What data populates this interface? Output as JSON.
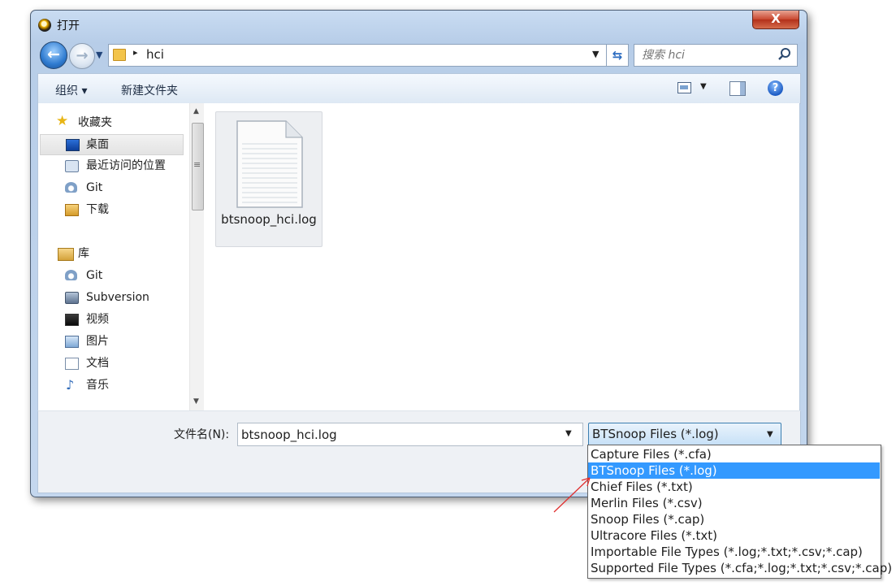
{
  "window": {
    "title": "打开",
    "close_glyph": "X"
  },
  "address": {
    "path_segment": "hci",
    "separator": "▸",
    "search_placeholder": "搜索 hci"
  },
  "toolbar": {
    "organize_label": "组织 ▾",
    "new_folder_label": "新建文件夹",
    "help_glyph": "?"
  },
  "nav": {
    "favorites_label": "收藏夹",
    "desktop_label": "桌面",
    "recent_label": "最近访问的位置",
    "git_label": "Git",
    "downloads_label": "下载",
    "libraries_label": "库",
    "lib_git_label": "Git",
    "subversion_label": "Subversion",
    "videos_label": "视频",
    "pictures_label": "图片",
    "documents_label": "文档",
    "music_label": "音乐"
  },
  "files": [
    {
      "name": "btsnoop_hci.log"
    }
  ],
  "bottom": {
    "filename_label": "文件名(N):",
    "filename_value": "btsnoop_hci.log",
    "filetype_selected": "BTSnoop Files (*.log)"
  },
  "filetype_options": [
    "Capture Files (*.cfa)",
    "BTSnoop Files (*.log)",
    "Chief Files (*.txt)",
    "Merlin Files (*.csv)",
    "Snoop Files (*.cap)",
    "Ultracore Files (*.txt)",
    "Importable File Types (*.log;*.txt;*.csv;*.cap)",
    "Supported File Types (*.cfa;*.log;*.txt;*.csv;*.cap)"
  ],
  "colors": {
    "selection_highlight": "#3399ff",
    "annotation_arrow": "#e03030",
    "frame": "#c4d7ee"
  },
  "icons": {
    "back": "arrow-left-icon",
    "forward": "arrow-right-icon",
    "refresh": "refresh-icon",
    "search": "search-icon",
    "help": "help-icon"
  }
}
